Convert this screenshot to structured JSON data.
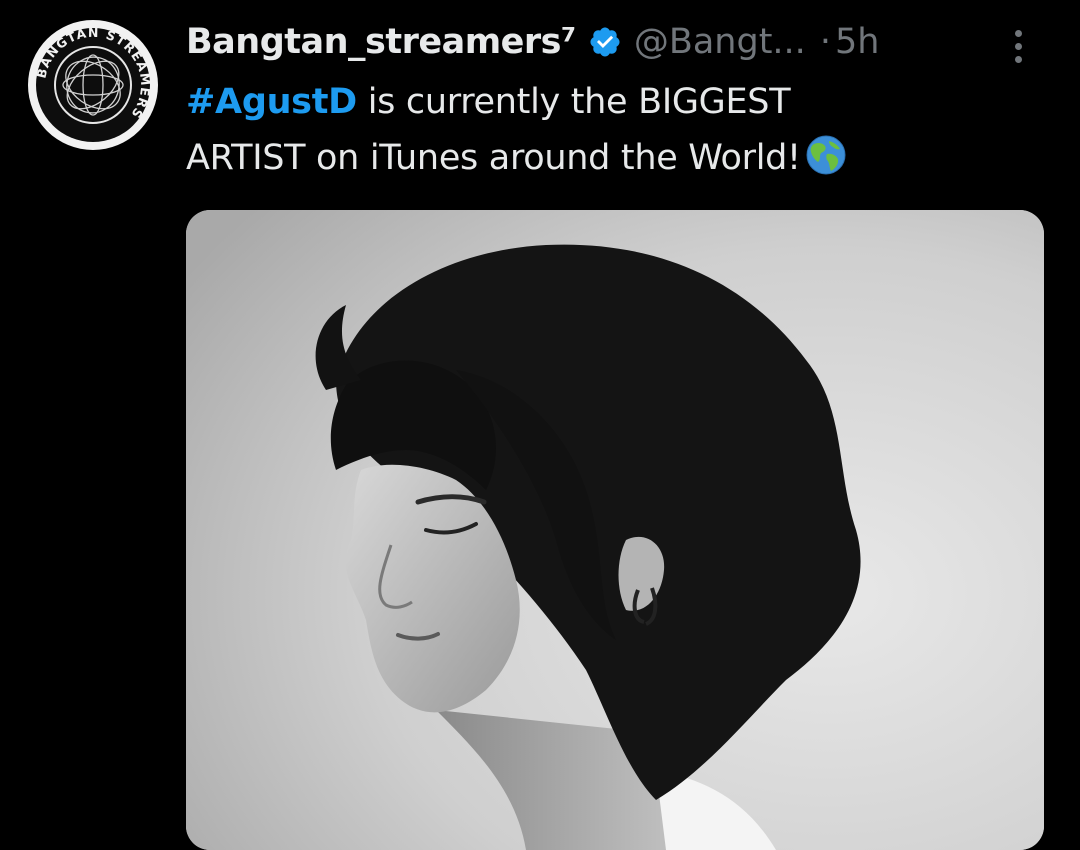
{
  "tweet": {
    "author": {
      "display_name": "Bangtan_streamers⁷",
      "handle": "@Bangt...",
      "avatar_text": "BANGTAN STREAMERS",
      "verified_icon": "verified-badge-icon"
    },
    "separator": "·",
    "time_ago": "5h",
    "text": {
      "hashtag": "#AgustD",
      "line1_rest": " is currently the BIGGEST",
      "line2": "ARTIST on iTunes around the World!",
      "emoji": "globe-icon"
    },
    "menu_icon": "more-icon",
    "media": {
      "type": "black-and-white portrait photo"
    }
  },
  "colors": {
    "background": "#000000",
    "text_primary": "#e7e9ea",
    "text_secondary": "#71767b",
    "accent": "#1d9bf0"
  }
}
